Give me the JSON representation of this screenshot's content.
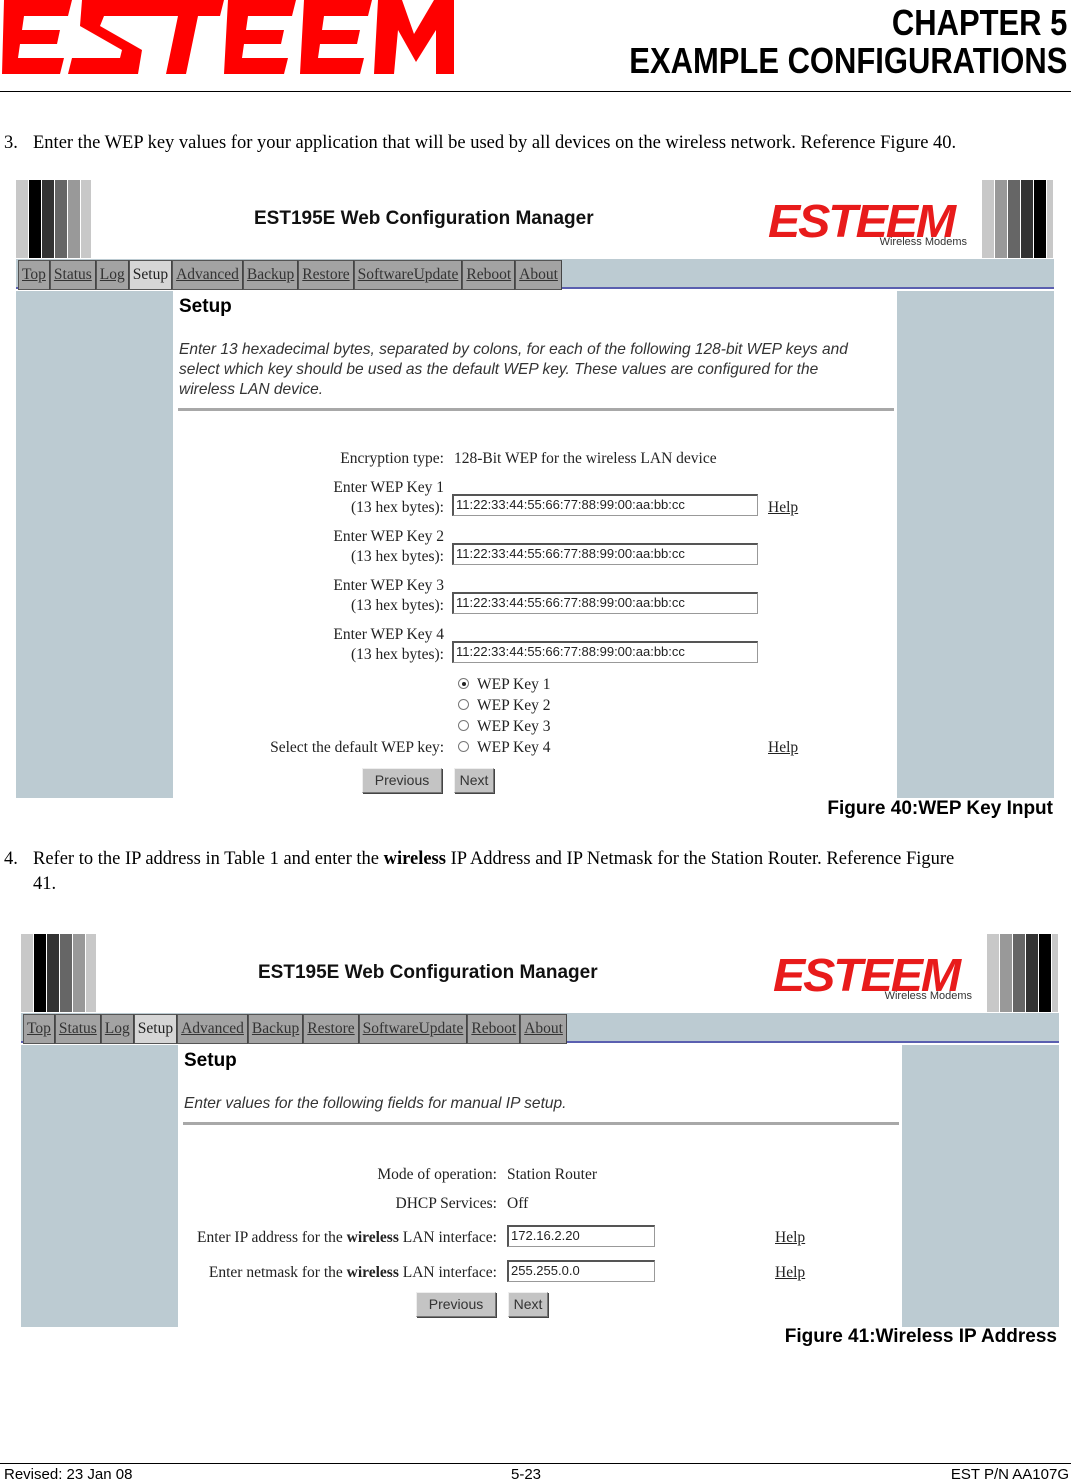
{
  "header": {
    "logo_text": "ESTEEM",
    "chapter_line1": "CHAPTER 5",
    "chapter_line2": "EXAMPLE CONFIGURATIONS"
  },
  "colors": {
    "brand_red": "#e81b1b",
    "nav_band": "#bccbd2",
    "nav_rule": "#5a5fb0",
    "tab_bg": "#a3a3a3",
    "tab_active_bg": "#d6d6d6"
  },
  "steps": [
    {
      "number": "3.",
      "text": "Enter the WEP key values for your application that will be used by all devices on the wireless network. Reference Figure 40."
    },
    {
      "number": "4.",
      "text_before": "Refer to the IP address in Table 1 and enter the ",
      "bold": "wireless",
      "text_after": " IP Address and IP Netmask for the Station Router.  Reference Figure",
      "text_cont": "41."
    }
  ],
  "app": {
    "title": "EST195E Web Configuration Manager",
    "brand": "ESTEEM",
    "brand_sub": "Wireless Modems",
    "tabs": [
      {
        "label": "Top",
        "active": false
      },
      {
        "label": "Status",
        "active": false
      },
      {
        "label": "Log",
        "active": false
      },
      {
        "label": "Setup",
        "active": true
      },
      {
        "label": "Advanced",
        "active": false
      },
      {
        "label": "Backup",
        "active": false
      },
      {
        "label": "Restore",
        "active": false
      },
      {
        "label": "SoftwareUpdate",
        "active": false
      },
      {
        "label": "Reboot",
        "active": false
      },
      {
        "label": "About",
        "active": false
      }
    ]
  },
  "figure40": {
    "heading": "Setup",
    "intro": "Enter 13 hexadecimal bytes, separated by colons, for each of the following 128-bit WEP keys and select which key should be used as the default WEP key. These values are configured for the wireless LAN device.",
    "encryption_label": "Encryption type:",
    "encryption_value": "128-Bit WEP for the wireless LAN device",
    "keys": [
      {
        "label1": "Enter WEP Key 1",
        "label2": "(13 hex bytes):",
        "value": "11:22:33:44:55:66:77:88:99:00:aa:bb:cc"
      },
      {
        "label1": "Enter WEP Key 2",
        "label2": "(13 hex bytes):",
        "value": "11:22:33:44:55:66:77:88:99:00:aa:bb:cc"
      },
      {
        "label1": "Enter WEP Key 3",
        "label2": "(13 hex bytes):",
        "value": "11:22:33:44:55:66:77:88:99:00:aa:bb:cc"
      },
      {
        "label1": "Enter WEP Key 4",
        "label2": "(13 hex bytes):",
        "value": "11:22:33:44:55:66:77:88:99:00:aa:bb:cc"
      }
    ],
    "default_key_label": "Select the default WEP key:",
    "radio_options": [
      "WEP Key 1",
      "WEP Key 2",
      "WEP Key 3",
      "WEP Key 4"
    ],
    "selected_key": "WEP Key 1",
    "help_label": "Help",
    "previous_label": "Previous",
    "next_label": "Next",
    "caption": "Figure 40:WEP Key Input"
  },
  "figure41": {
    "heading": "Setup",
    "intro": "Enter values for the following fields for manual IP setup.",
    "mode_label": "Mode of operation:",
    "mode_value": "Station Router",
    "dhcp_label": "DHCP Services:",
    "dhcp_value": "Off",
    "ip_label_before": "Enter IP address for the ",
    "ip_label_bold": "wireless",
    "ip_label_after": " LAN interface:",
    "ip_value": "172.16.2.20",
    "mask_label_before": "Enter netmask for the ",
    "mask_label_bold": "wireless",
    "mask_label_after": " LAN interface:",
    "mask_value": "255.255.0.0",
    "help_label": "Help",
    "previous_label": "Previous",
    "next_label": "Next",
    "caption": "Figure 41:Wireless IP Address"
  },
  "footer": {
    "revised": "Revised: 23 Jan 08",
    "page": "5-23",
    "part_number": "EST P/N AA107G"
  }
}
